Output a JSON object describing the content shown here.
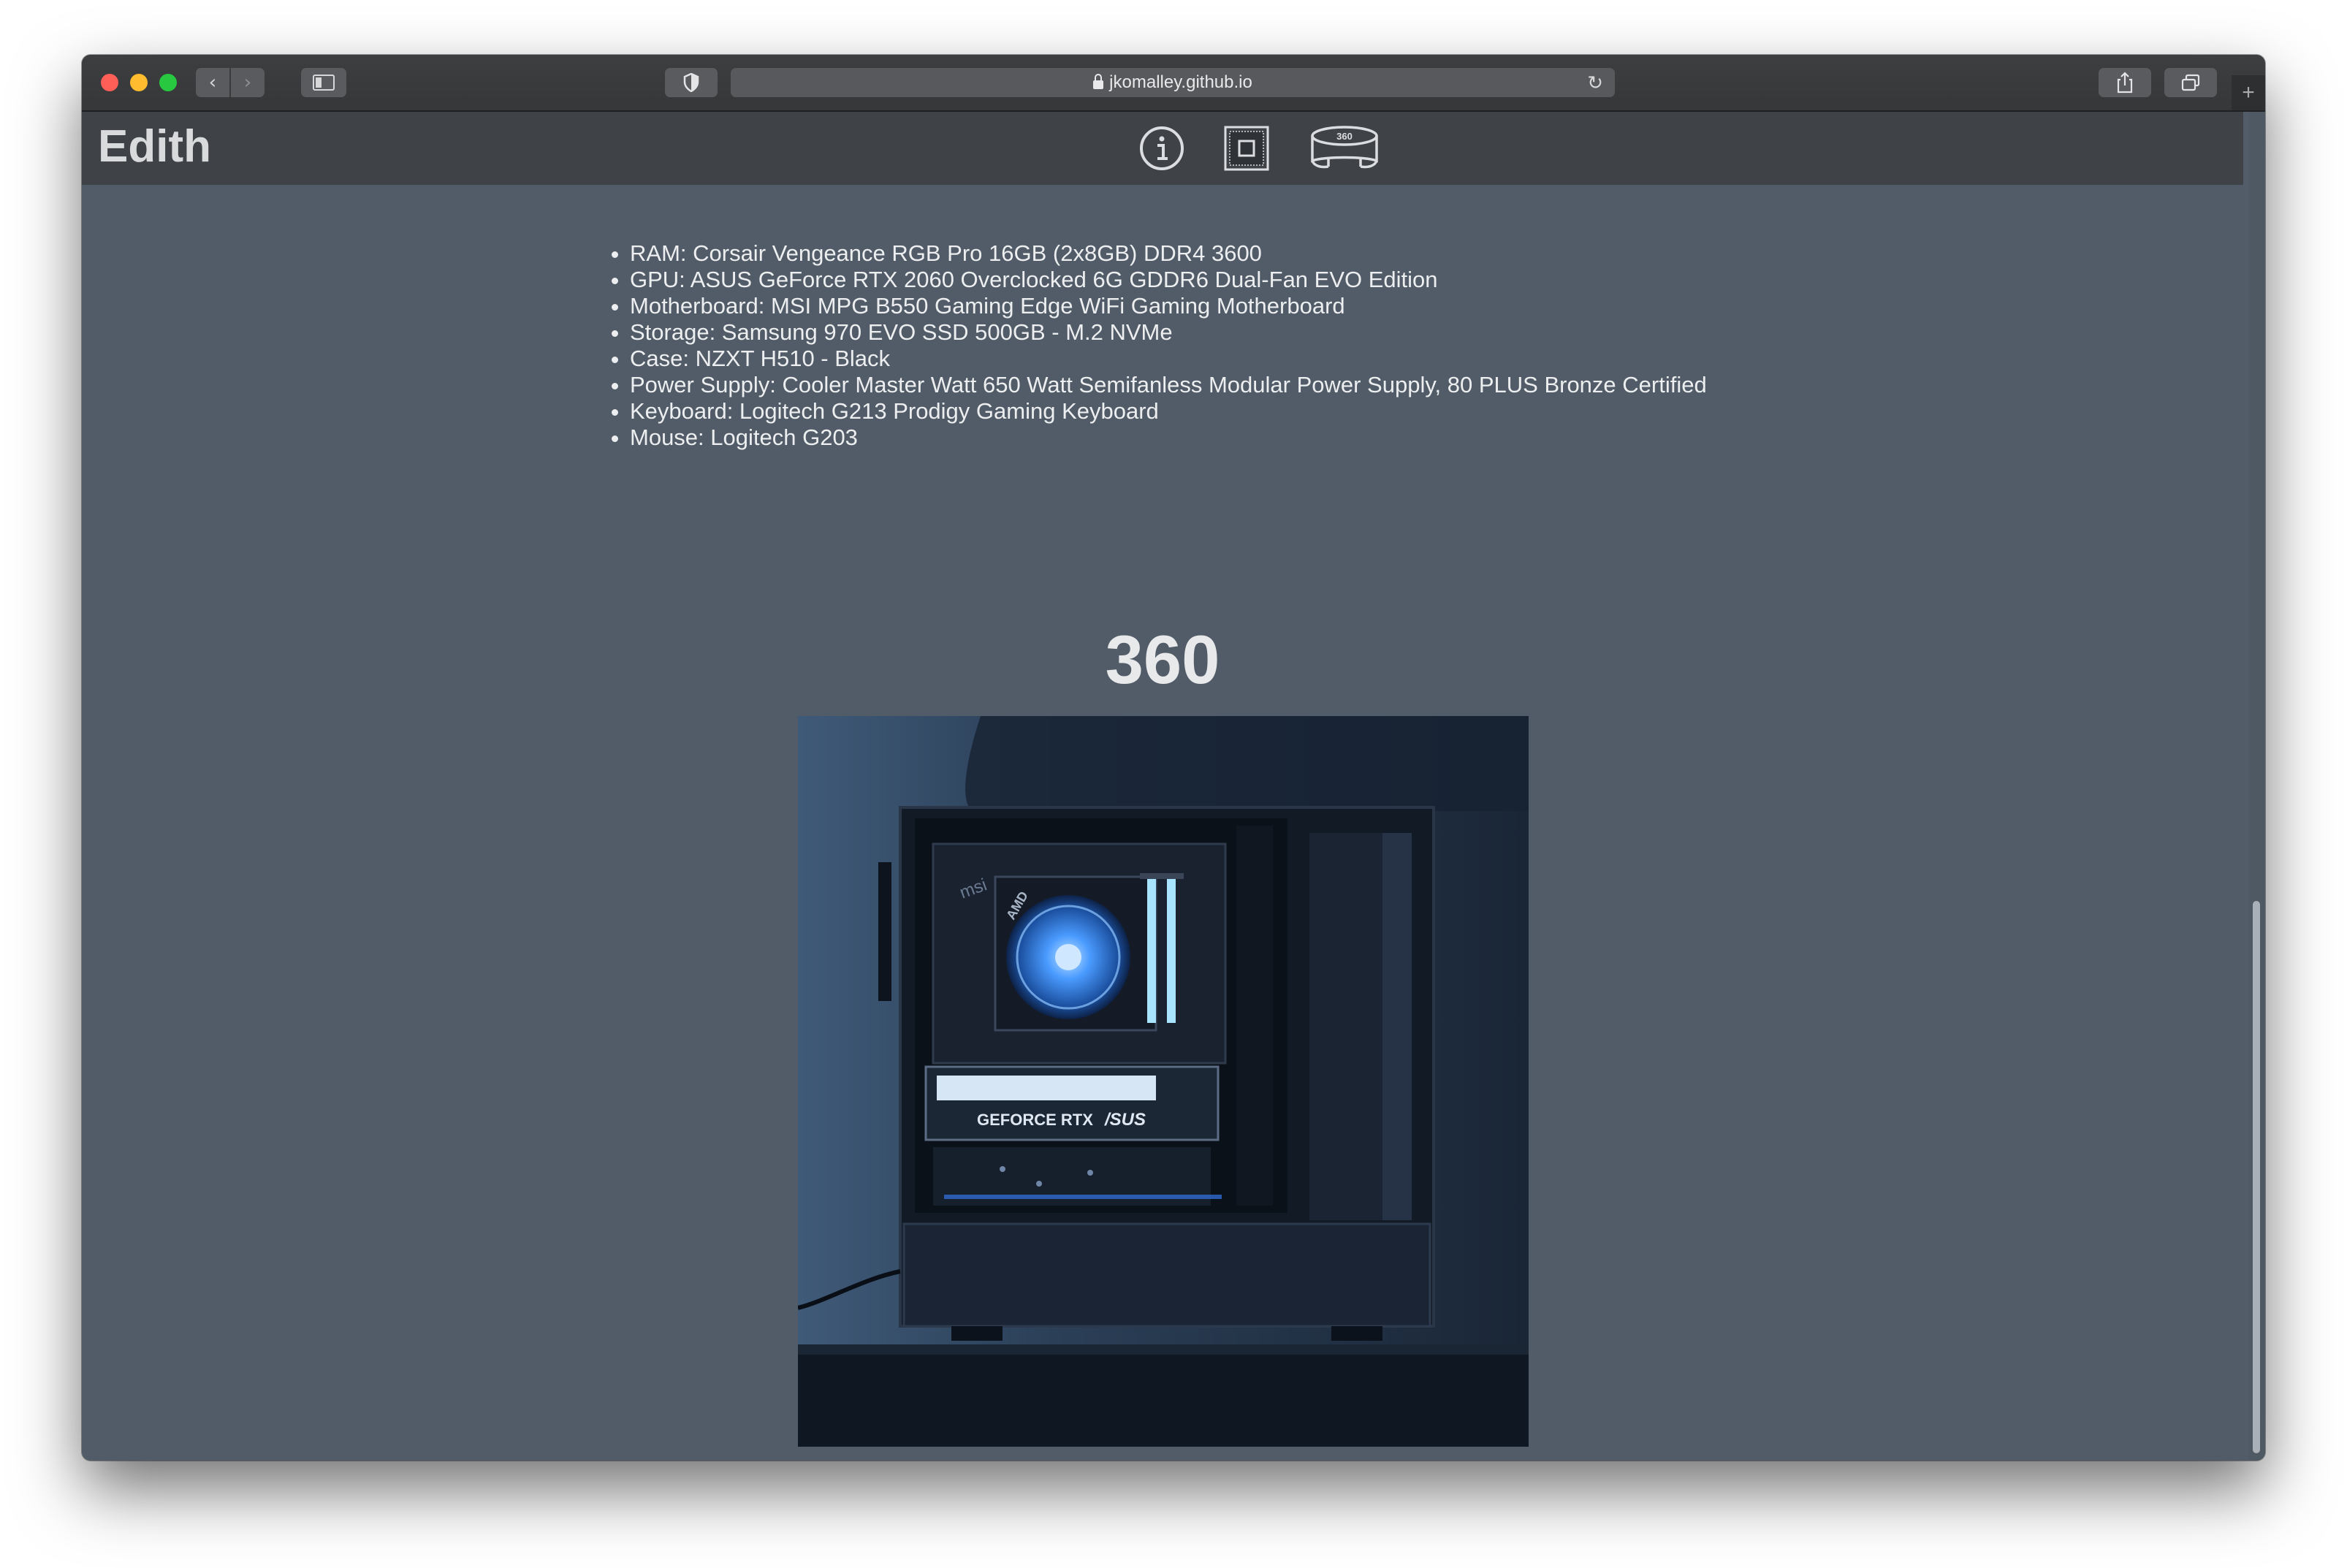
{
  "browser": {
    "url": "jkomalley.github.io",
    "icons": [
      "back-icon",
      "forward-icon",
      "sidebar-icon",
      "shield-icon",
      "lock-icon",
      "reload-icon",
      "share-icon",
      "tabs-icon",
      "new-tab-icon"
    ]
  },
  "site": {
    "brand": "Edith",
    "nav": [
      {
        "icon": "info-icon"
      },
      {
        "icon": "cpu-icon"
      },
      {
        "icon": "view-360-icon",
        "label": "360"
      }
    ]
  },
  "specs": [
    "RAM: Corsair Vengeance RGB Pro 16GB (2x8GB) DDR4 3600",
    "GPU: ASUS GeForce RTX 2060 Overclocked 6G GDDR6 Dual-Fan EVO Edition",
    "Motherboard: MSI MPG B550 Gaming Edge WiFi Gaming Motherboard",
    "Storage: Samsung 970 EVO SSD 500GB - M.2 NVMe",
    "Case: NZXT H510 - Black",
    "Power Supply: Cooler Master Watt 650 Watt Semifanless Modular Power Supply, 80 PLUS Bronze Certified",
    "Keyboard: Logitech G213 Prodigy Gaming Keyboard",
    "Mouse: Logitech G203"
  ],
  "section": {
    "title": "360"
  },
  "photo": {
    "gpu_text": "GEFORCE RTX",
    "brand_text": "/SUS",
    "board_text": "msi",
    "cooler_text": "AMD"
  },
  "colors": {
    "page_bg": "#525c68",
    "header_bg": "#3f4348",
    "text": "#eceeef",
    "accent_blue": "#5aa7ff"
  }
}
